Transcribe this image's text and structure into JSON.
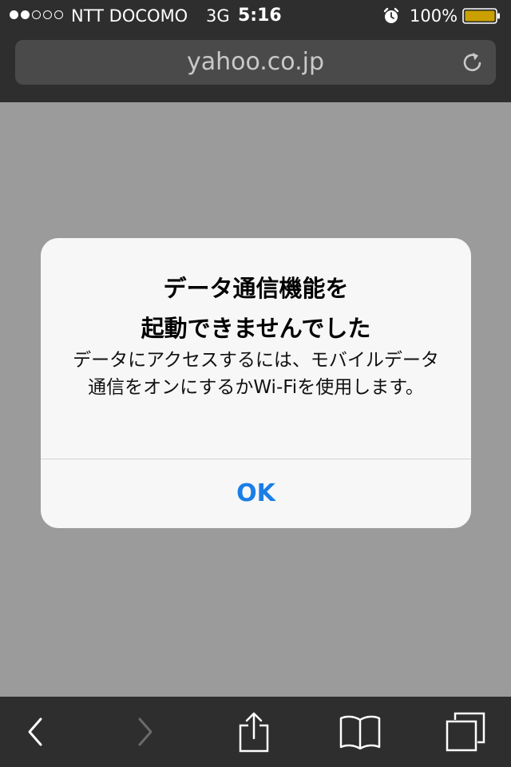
{
  "status_bar": {
    "signal_dots": [
      true,
      true,
      false,
      false,
      false
    ],
    "carrier": "NTT DOCOMO",
    "network": "3G",
    "time": "5:16",
    "battery_percent": "100%",
    "battery_level": 1.0,
    "battery_color": "#c9a000"
  },
  "address_bar": {
    "url": "yahoo.co.jp"
  },
  "alert": {
    "title": "データ通信機能を\n起動できませんでした",
    "message": "データにアクセスするには、モバイルデータ通信をオンにするかWi-Fiを使用します。",
    "ok_label": "OK",
    "ok_color": "#1a7ee6"
  },
  "toolbar": {
    "icons": [
      "back-icon",
      "forward-icon",
      "share-icon",
      "bookmarks-icon",
      "tabs-icon"
    ]
  }
}
